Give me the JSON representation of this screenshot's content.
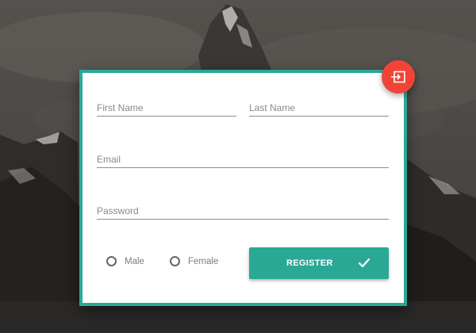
{
  "form": {
    "first_name_placeholder": "First Name",
    "last_name_placeholder": "Last Name",
    "email_placeholder": "Email",
    "password_placeholder": "Password",
    "gender_options": [
      "Male",
      "Female"
    ],
    "register_label": "REGISTER"
  },
  "icons": {
    "fab": "login-icon",
    "submit": "check-icon"
  },
  "colors": {
    "accent": "#2aa896",
    "fab": "#f14436",
    "card": "#ffffff",
    "underline": "#8d8d8d",
    "placeholder": "#8a8a8a"
  }
}
